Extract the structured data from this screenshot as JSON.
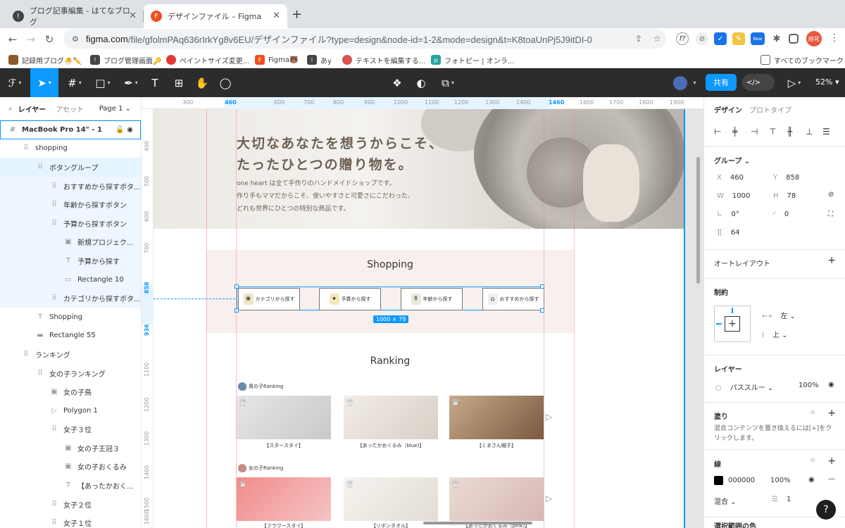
{
  "browser": {
    "tabs": [
      {
        "title": "ブログ記事編集 - はてなブログ",
        "active": false
      },
      {
        "title": "デザインファイル – Figma",
        "active": true
      }
    ],
    "url_host": "figma.com",
    "url_path": "/file/gfolmPAq636rIrkYg8v6EU/デザインファイル?type=design&node-id=1-2&mode=design&t=K8toaUnPj5J9itDI-0",
    "ext_new_badge": "New",
    "profile_label": "綾花",
    "bookmarks": [
      "記録用ブログ🐣✏️",
      "ブログ管理画面🔑",
      "ペイントサイズ変更...",
      "Figma🐻",
      "あy",
      "テキストを編集する...",
      "フォトピー | オンラ...",
      "すべてのブックマーク"
    ]
  },
  "toolbar": {
    "share_label": "共有",
    "dev_label": "</>",
    "zoom": "52%"
  },
  "layers_panel": {
    "tab_layers": "レイヤー",
    "tab_assets": "アセット",
    "page_name": "Page 1",
    "items": [
      {
        "name": "MacBook Pro 14\" - 1",
        "icon": "#",
        "indent": 0
      },
      {
        "name": "shopping",
        "icon": "⠿",
        "indent": 1
      },
      {
        "name": "ボタングループ",
        "icon": "⠿",
        "indent": 2
      },
      {
        "name": "おすすめから探すボタ...",
        "icon": "⠿",
        "indent": 3
      },
      {
        "name": "年齢から探すボタン",
        "icon": "⠿",
        "indent": 3
      },
      {
        "name": "予算から探すボタン",
        "icon": "⠿",
        "indent": 3
      },
      {
        "name": "新規プロジェク...",
        "icon": "▣",
        "indent": 4
      },
      {
        "name": "予算から探す",
        "icon": "T",
        "indent": 4
      },
      {
        "name": "Rectangle 10",
        "icon": "▭",
        "indent": 4
      },
      {
        "name": "カテゴリから探すボタ...",
        "icon": "⠿",
        "indent": 3
      },
      {
        "name": "Shopping",
        "icon": "T",
        "indent": 2
      },
      {
        "name": "Rectangle 55",
        "icon": "▬",
        "indent": 2
      },
      {
        "name": "ランキング",
        "icon": "⠿",
        "indent": 1
      },
      {
        "name": "女の子ランキング",
        "icon": "⠿",
        "indent": 2
      },
      {
        "name": "女の子鳥",
        "icon": "▣",
        "indent": 3
      },
      {
        "name": "Polygon 1",
        "icon": "▷",
        "indent": 3
      },
      {
        "name": "女子３位",
        "icon": "⠿",
        "indent": 3
      },
      {
        "name": "女の子王冠３",
        "icon": "▣",
        "indent": 4
      },
      {
        "name": "女の子おくるみ",
        "icon": "▣",
        "indent": 4
      },
      {
        "name": "【あったかおく...",
        "icon": "T",
        "indent": 4
      },
      {
        "name": "女子２位",
        "icon": "⠿",
        "indent": 3
      },
      {
        "name": "女子１位",
        "icon": "⠿",
        "indent": 3
      }
    ]
  },
  "rulers": {
    "h": [
      "300",
      "460",
      "600",
      "700",
      "800",
      "900",
      "1000",
      "1100",
      "1200",
      "1300",
      "1400",
      "1460",
      "1600",
      "1700",
      "1800",
      "1900"
    ],
    "v": [
      "400",
      "500",
      "600",
      "700",
      "858",
      "936",
      "1100",
      "1200",
      "1300",
      "1400",
      "1500",
      "1600"
    ]
  },
  "canvas": {
    "hero_title_1": "大切なあなたを想うからこそ、",
    "hero_title_2": "たったひとつの贈り物を。",
    "hero_text_1": "one heart は全て手作りのハンドメイドショップです。",
    "hero_text_2": "作り手もママだからこそ、使いやすさと可愛さにこだわった、",
    "hero_text_3": "どれも世界にひとつの特別な商品です。",
    "shopping_title": "Shopping",
    "buttons": [
      "カテゴリから探す",
      "予算から探す",
      "年齢から探す",
      "おすすめから探す"
    ],
    "selection_size": "1000 × 78",
    "ranking_title": "Ranking",
    "boys_label": "男の子Ranking",
    "girls_label": "女の子Ranking",
    "boys_products": [
      "【スタースタイ】",
      "【あったかおくるみ（blue)】",
      "【くまさん帽子】"
    ],
    "girls_products": [
      "【フラワースタイ】",
      "【リボンタオル】",
      "【あったかおくるみ（pink)】"
    ]
  },
  "design_panel": {
    "tab_design": "デザイン",
    "tab_prototype": "プロトタイプ",
    "group_label": "グループ",
    "x_label": "X",
    "x": "460",
    "y_label": "Y",
    "y": "858",
    "w_label": "W",
    "w": "1000",
    "h_label": "H",
    "h": "78",
    "rotation": "0°",
    "radius": "0",
    "spacing": "64",
    "autolayout": "オートレイアウト",
    "constraints": "制約",
    "constraint_h": "左",
    "constraint_v": "上",
    "layer_section": "レイヤー",
    "blend": "パススルー",
    "opacity": "100%",
    "fill_section": "塗り",
    "fill_note": "混合コンテンツを置き換えるには[+]をクリックします。",
    "stroke_section": "線",
    "stroke_color": "000000",
    "stroke_opacity": "100%",
    "stroke_blend": "混合",
    "stroke_weight": "1",
    "selection_colors": "選択範囲の色"
  }
}
